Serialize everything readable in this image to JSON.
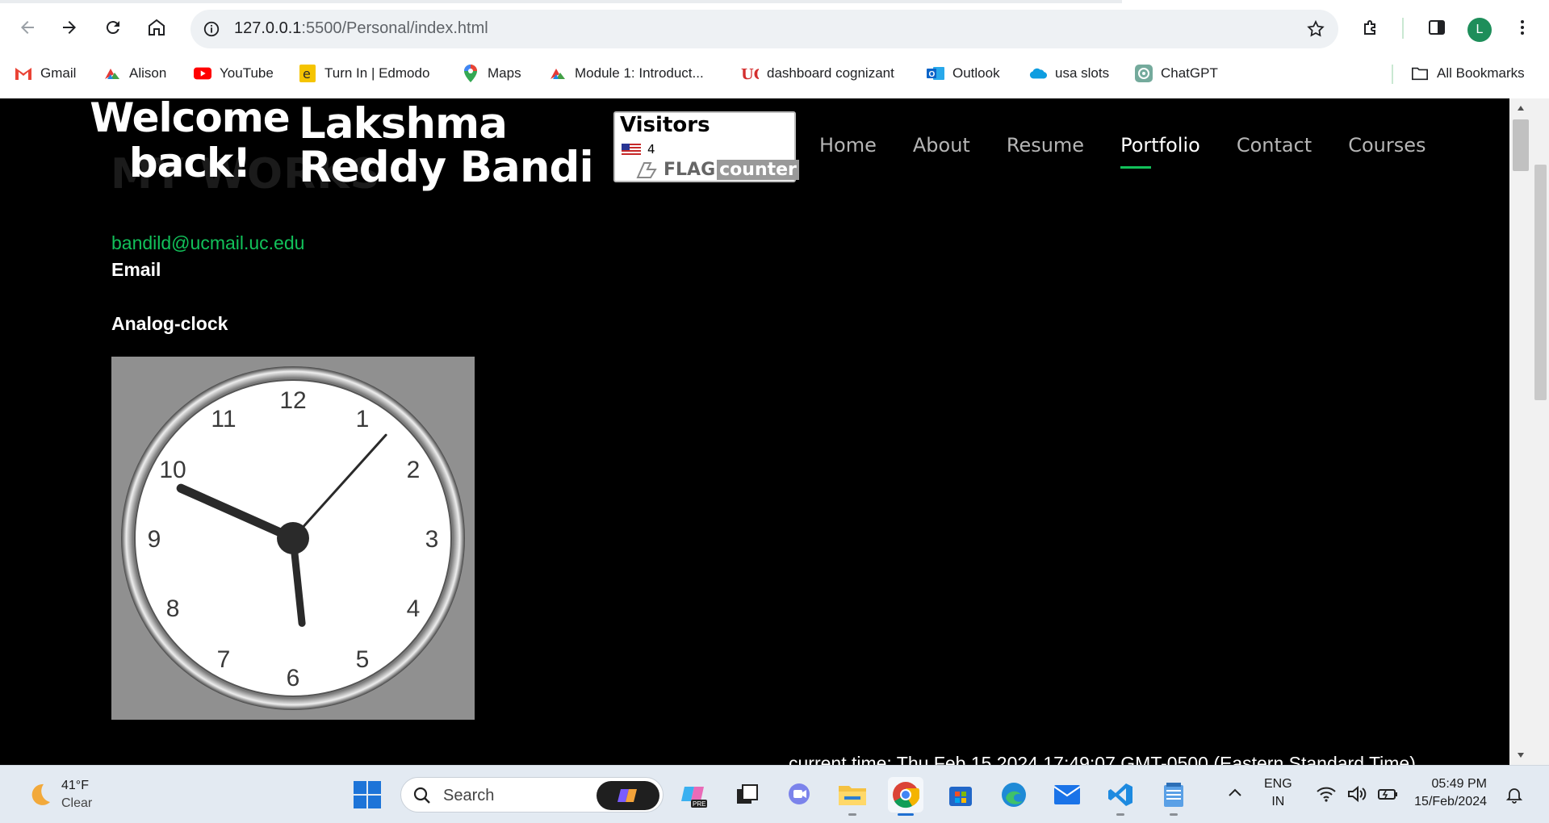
{
  "browser": {
    "url_host": "127.0.0.1",
    "url_rest": ":5500/Personal/index.html",
    "profile_initial": "L",
    "bookmarks": [
      {
        "label": "Gmail",
        "icon": "gmail-icon"
      },
      {
        "label": "Alison",
        "icon": "alison-icon"
      },
      {
        "label": "YouTube",
        "icon": "youtube-icon"
      },
      {
        "label": "Turn In | Edmodo",
        "icon": "edmodo-icon"
      },
      {
        "label": "Maps",
        "icon": "maps-icon"
      },
      {
        "label": "Module 1: Introduct...",
        "icon": "alison-icon"
      },
      {
        "label": "dashboard cognizant",
        "icon": "uc-icon"
      },
      {
        "label": "Outlook",
        "icon": "outlook-icon"
      },
      {
        "label": "usa slots",
        "icon": "salesforce-icon"
      },
      {
        "label": "ChatGPT",
        "icon": "chatgpt-icon"
      }
    ],
    "all_bookmarks": "All Bookmarks"
  },
  "page": {
    "bg_heading": "MY WORKS",
    "welcome": "Welcome back!",
    "name": "Lakshma Reddy Bandi",
    "flag_counter": {
      "title": "Visitors",
      "count": "4",
      "brand_flag": "FLAG",
      "brand_counter": "counter"
    },
    "nav": [
      {
        "label": "Home",
        "active": false
      },
      {
        "label": "About",
        "active": false
      },
      {
        "label": "Resume",
        "active": false
      },
      {
        "label": "Portfolio",
        "active": true
      },
      {
        "label": "Contact",
        "active": false
      },
      {
        "label": "Courses",
        "active": false
      }
    ],
    "email_link": "bandild@ucmail.uc.edu",
    "email_label": "Email",
    "clock_title": "Analog-clock",
    "clock": {
      "numbers": [
        "12",
        "1",
        "2",
        "3",
        "4",
        "5",
        "6",
        "7",
        "8",
        "9",
        "10",
        "11"
      ],
      "hour_angle_deg": 294,
      "minute_angle_deg": 174,
      "second_angle_deg": 42
    },
    "current_time": "current time: Thu Feb 15 2024 17:49:07 GMT-0500 (Eastern Standard Time)"
  },
  "taskbar": {
    "temperature": "41°F",
    "condition": "Clear",
    "search_placeholder": "Search",
    "language_top": "ENG",
    "language_bottom": "IN",
    "time": "05:49 PM",
    "date": "15/Feb/2024"
  },
  "colors": {
    "accent_green": "#12c15a",
    "page_bg": "#000000"
  }
}
